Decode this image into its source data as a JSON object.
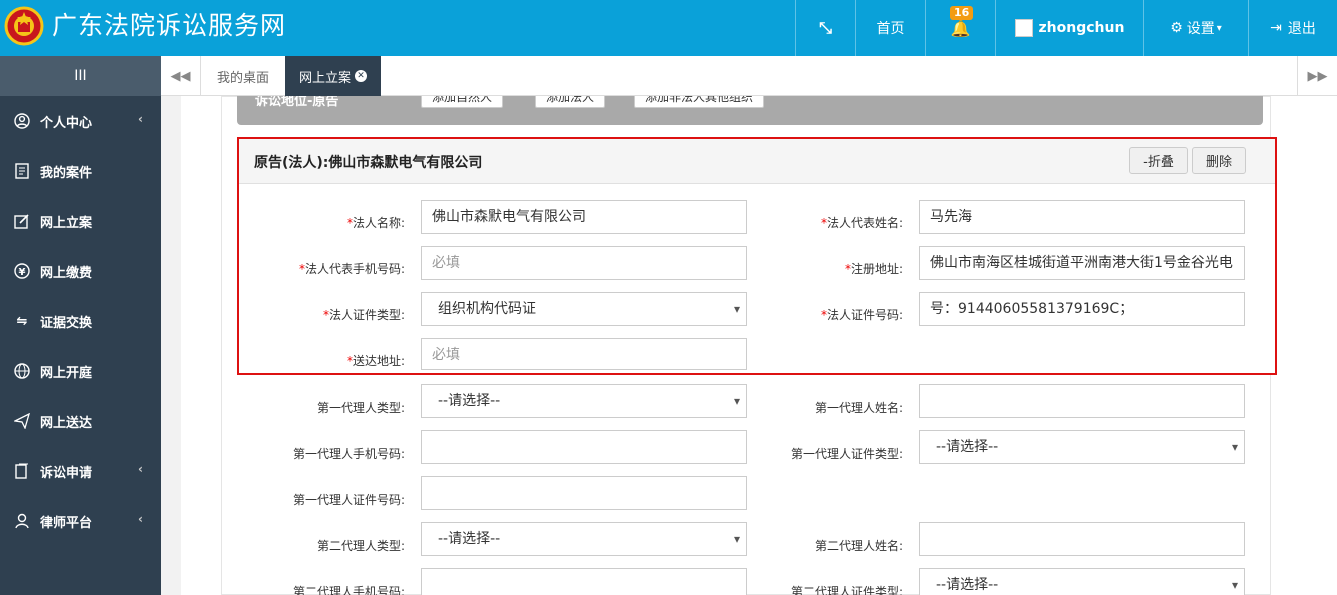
{
  "header": {
    "site_title": "广东法院诉讼服务网",
    "home": "首页",
    "bell_badge": "16",
    "username": "zhongchun",
    "settings": "设置",
    "logout": "退出"
  },
  "sidebar": {
    "toggle": "III",
    "items": [
      {
        "label": "个人中心",
        "icon": "user-icon",
        "arrow": true
      },
      {
        "label": "我的案件",
        "icon": "document-icon",
        "arrow": false
      },
      {
        "label": "网上立案",
        "icon": "edit-icon",
        "arrow": false
      },
      {
        "label": "网上缴费",
        "icon": "yen-icon",
        "arrow": false
      },
      {
        "label": "证据交换",
        "icon": "exchange-icon",
        "arrow": false
      },
      {
        "label": "网上开庭",
        "icon": "globe-icon",
        "arrow": false
      },
      {
        "label": "网上送达",
        "icon": "send-icon",
        "arrow": false
      },
      {
        "label": "诉讼申请",
        "icon": "file-icon",
        "arrow": true
      },
      {
        "label": "律师平台",
        "icon": "person-icon",
        "arrow": true
      }
    ]
  },
  "tabs": {
    "desktop": "我的桌面",
    "filing": "网上立案"
  },
  "top_bar": {
    "label": "诉讼地位-原告",
    "btn_natural": "添加自然人",
    "btn_legal": "添加法人",
    "btn_other": "添加非法人其他组织"
  },
  "plaintiff": {
    "title": "原告(法人):佛山市森默电气有限公司",
    "fold": "-折叠",
    "delete": "删除",
    "fields": {
      "legal_name_label": "法人名称:",
      "legal_name": "佛山市森默电气有限公司",
      "rep_name_label": "法人代表姓名:",
      "rep_name": "马先海",
      "rep_phone_label": "法人代表手机号码:",
      "rep_phone_placeholder": "必填",
      "reg_addr_label": "注册地址:",
      "reg_addr": "佛山市南海区桂城街道平洲南港大街1号金谷光电",
      "cert_type_label": "法人证件类型:",
      "cert_type": "组织机构代码证",
      "cert_no_label": "法人证件号码:",
      "cert_no": "号：91440605581379169C；",
      "delivery_addr_label": "送达地址:",
      "delivery_addr_placeholder": "必填"
    }
  },
  "agents": {
    "a1_type_label": "第一代理人类型:",
    "a1_type": "--请选择--",
    "a1_name_label": "第一代理人姓名:",
    "a1_phone_label": "第一代理人手机号码:",
    "a1_cert_type_label": "第一代理人证件类型:",
    "a1_cert_type": "--请选择--",
    "a1_cert_no_label": "第一代理人证件号码:",
    "a2_type_label": "第二代理人类型:",
    "a2_type": "--请选择--",
    "a2_name_label": "第二代理人姓名:",
    "a2_phone_label": "第二代理人手机号码:",
    "a2_cert_type_label": "第二代理人证件类型:",
    "a2_cert_type": "--请选择--"
  },
  "colors": {
    "header": "#0aa1d9",
    "sidebar": "#2f4050",
    "highlight": "#dd1111",
    "badge": "#f39c12"
  }
}
